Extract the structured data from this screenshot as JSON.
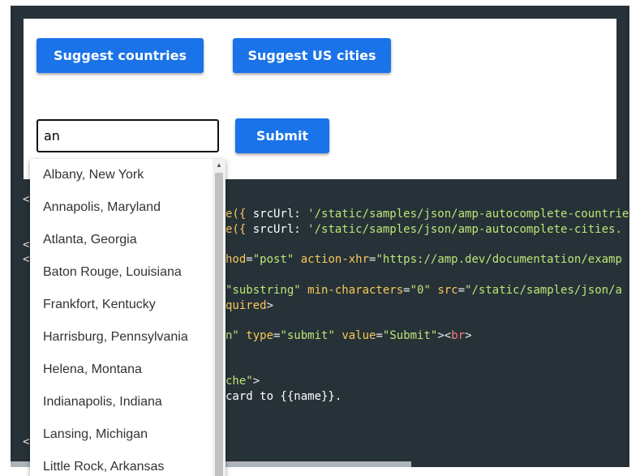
{
  "buttons": {
    "suggest_countries": "Suggest countries",
    "suggest_us_cities": "Suggest US cities",
    "submit": "Submit"
  },
  "search": {
    "value": "an"
  },
  "suggestions": [
    "Albany, New York",
    "Annapolis, Maryland",
    "Atlanta, Georgia",
    "Baton Rouge, Louisiana",
    "Frankfort, Kentucky",
    "Harrisburg, Pennsylvania",
    "Helena, Montana",
    "Indianapolis, Indiana",
    "Lansing, Michigan",
    "Little Rock, Arkansas"
  ],
  "code_lines": [
    [
      {
        "t": "<",
        "c": "punct"
      }
    ],
    [
      {
        "t": "e({ ",
        "c": "attr"
      },
      {
        "t": "srcUrl: ",
        "c": "text"
      },
      {
        "t": "'/static/samples/json/amp-autocomplete-countries",
        "c": "str"
      }
    ],
    [
      {
        "t": "e({ ",
        "c": "attr"
      },
      {
        "t": "srcUrl: ",
        "c": "text"
      },
      {
        "t": "'/static/samples/json/amp-autocomplete-cities.",
        "c": "str"
      }
    ],
    [
      {
        "t": "<",
        "c": "punct"
      }
    ],
    [
      {
        "t": "<",
        "c": "punct"
      }
    ],
    [
      {
        "t": "hod",
        "c": "attr"
      },
      {
        "t": "=",
        "c": "punct"
      },
      {
        "t": "\"post\"",
        "c": "str"
      },
      {
        "t": " action-xhr",
        "c": "attr"
      },
      {
        "t": "=",
        "c": "punct"
      },
      {
        "t": "\"https://amp.dev/documentation/examp",
        "c": "str"
      }
    ],
    [
      {
        "t": "\"substring\"",
        "c": "str"
      },
      {
        "t": " min-characters",
        "c": "attr"
      },
      {
        "t": "=",
        "c": "punct"
      },
      {
        "t": "\"0\"",
        "c": "str"
      },
      {
        "t": " src",
        "c": "attr"
      },
      {
        "t": "=",
        "c": "punct"
      },
      {
        "t": "\"/static/samples/json/a",
        "c": "str"
      }
    ],
    [
      {
        "t": "quired",
        "c": "attr"
      },
      {
        "t": ">",
        "c": "punct"
      }
    ],
    [
      {
        "t": "n\"",
        "c": "str"
      },
      {
        "t": " type",
        "c": "attr"
      },
      {
        "t": "=",
        "c": "punct"
      },
      {
        "t": "\"submit\"",
        "c": "str"
      },
      {
        "t": " value",
        "c": "attr"
      },
      {
        "t": "=",
        "c": "punct"
      },
      {
        "t": "\"Submit\"",
        "c": "str"
      },
      {
        "t": "><",
        "c": "punct"
      },
      {
        "t": "br",
        "c": "tag"
      },
      {
        "t": ">",
        "c": "punct"
      }
    ],
    [
      {
        "t": "che\"",
        "c": "str"
      },
      {
        "t": ">",
        "c": "punct"
      }
    ],
    [
      {
        "t": "card to {{name}}.",
        "c": "text"
      }
    ],
    [
      {
        "t": "<",
        "c": "punct"
      }
    ]
  ]
}
